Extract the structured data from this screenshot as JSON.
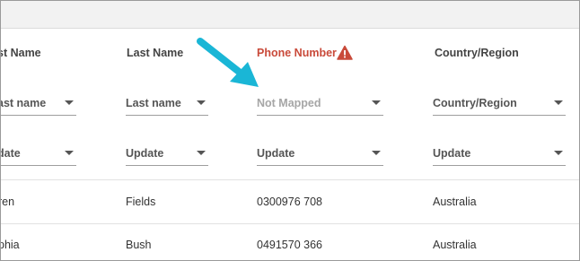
{
  "columns": [
    {
      "header": "st Name",
      "mapping": "ast name",
      "action": "date"
    },
    {
      "header": "Last Name",
      "mapping": "Last name",
      "action": "Update"
    },
    {
      "header": "Phone Number",
      "mapping": "Not Mapped",
      "action": "Update",
      "error": true
    },
    {
      "header": "Country/Region",
      "mapping": "Country/Region",
      "action": "Update"
    }
  ],
  "rows": [
    {
      "first": "ren",
      "last": "Fields",
      "phone": "0300976 708",
      "country": "Australia"
    },
    {
      "first": "phia",
      "last": "Bush",
      "phone": "0491570 366",
      "country": "Australia"
    }
  ],
  "icons": {
    "warning": "warning-triangle-icon",
    "arrow": "pointer-arrow-icon",
    "dropdown": "dropdown-caret-icon"
  },
  "colors": {
    "error": "#c94a3a",
    "arrow": "#1ab6d6",
    "muted": "#a6a6a6"
  }
}
